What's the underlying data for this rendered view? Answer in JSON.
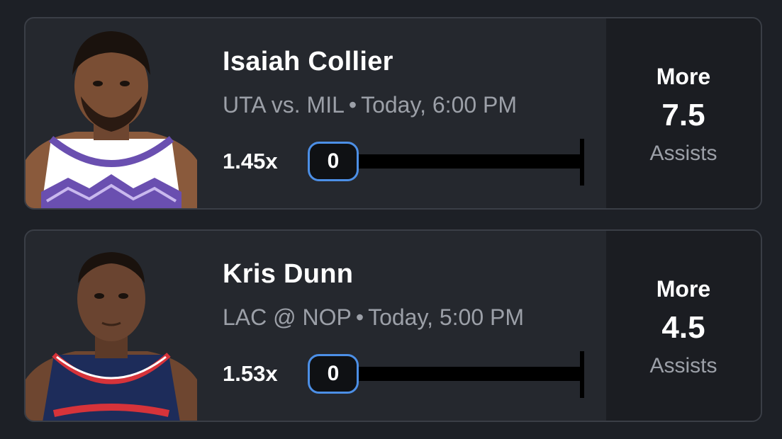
{
  "picks": [
    {
      "player_name": "Isaiah Collier",
      "matchup": "UTA vs. MIL",
      "time": "Today, 6:00 PM",
      "multiplier": "1.45x",
      "progress_current": "0",
      "progress_fraction": 0,
      "direction": "More",
      "line": "7.5",
      "stat": "Assists",
      "jersey_color": "#ffffff",
      "jersey_accent": "#6a4fb0"
    },
    {
      "player_name": "Kris Dunn",
      "matchup": "LAC @ NOP",
      "time": "Today, 5:00 PM",
      "multiplier": "1.53x",
      "progress_current": "0",
      "progress_fraction": 0,
      "direction": "More",
      "line": "4.5",
      "stat": "Assists",
      "jersey_color": "#1d2c5a",
      "jersey_accent": "#d6333a"
    }
  ],
  "separator": "•",
  "colors": {
    "background": "#1d2026",
    "card": "#25282e",
    "panel": "#1b1d22",
    "accent_blue": "#4c8fe6",
    "muted_text": "#9ca0a8"
  },
  "icons": {
    "avatar": "player-headshot"
  }
}
